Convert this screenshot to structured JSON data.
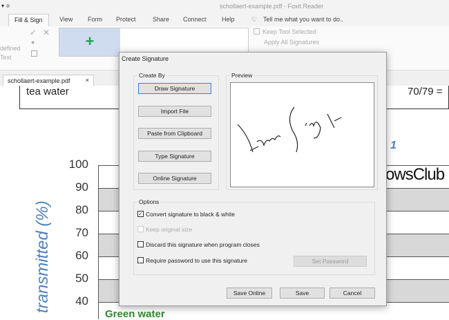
{
  "window": {
    "title": "schollaert-example.pdf - Foxit Reader"
  },
  "ribbon": {
    "tabs": [
      "Fill & Sign",
      "View",
      "Form",
      "Protect",
      "Share",
      "Connect",
      "Help"
    ],
    "tell_me": "Tell me what you want to do..",
    "predefined_text": "defined",
    "text_label": "Text",
    "keep_tool_selected": "Keep Tool Selected",
    "apply_all_signatures": "Apply All Signatures"
  },
  "doc_tab": {
    "name": "schollaert-example.pdf"
  },
  "document": {
    "cell_text": "tea water",
    "ratio_text": "70/79 =",
    "fig_fragment": "1",
    "y_axis_label": "transmitted (%)",
    "y_ticks": [
      "100",
      "90",
      "80",
      "70",
      "60",
      "50",
      "40"
    ],
    "green_label": "Green water"
  },
  "dialog": {
    "title": "Create Signature",
    "create_by_label": "Create By",
    "buttons": [
      "Draw Signature",
      "Import File",
      "Paste from Clipboard",
      "Type Signature",
      "Online Signature"
    ],
    "preview_label": "Preview",
    "options_label": "Options",
    "options": [
      {
        "label": "Convert signature to black & white",
        "checked": true,
        "enabled": true
      },
      {
        "label": "Keep original size",
        "checked": false,
        "enabled": false
      },
      {
        "label": "Discard this signature when program closes",
        "checked": false,
        "enabled": true
      },
      {
        "label": "Require password to use this signature",
        "checked": false,
        "enabled": true
      }
    ],
    "set_password": "Set Password",
    "save_online": "Save Online",
    "save": "Save",
    "cancel": "Cancel"
  },
  "watermark": "TheWindowsClub"
}
